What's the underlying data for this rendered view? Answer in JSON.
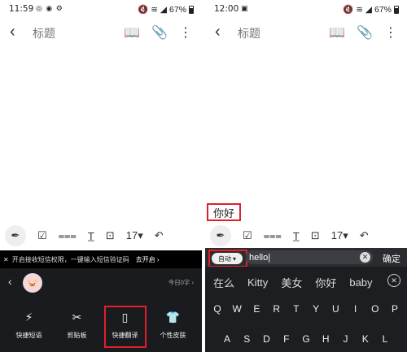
{
  "left": {
    "status": {
      "time": "11:59",
      "status_icons": "◎ ◉ ⚙",
      "right_icons": "🔇 ≋ ◢",
      "battery": "67%"
    },
    "topbar": {
      "title": "标题"
    },
    "format_toolbar": {
      "font_size": "17"
    },
    "notice": {
      "text": "开启接收短信权限，一键输入短信验证码",
      "action": "去开启"
    },
    "today_label": "今日0字",
    "tools": [
      {
        "label": "快捷短语",
        "icon": "phrase-icon"
      },
      {
        "label": "剪贴板",
        "icon": "scissors-icon"
      },
      {
        "label": "快捷翻译",
        "icon": "translate-icon"
      },
      {
        "label": "个性皮肤",
        "icon": "shirt-icon"
      }
    ]
  },
  "right": {
    "status": {
      "time": "12:00",
      "status_icons": "▣",
      "right_icons": "🔇 ≋ ◢",
      "battery": "67%"
    },
    "topbar": {
      "title": "标题"
    },
    "note_text": "你好",
    "format_toolbar": {
      "font_size": "17"
    },
    "translate_bar": {
      "mode": "自动",
      "input_value": "hello",
      "confirm": "确定"
    },
    "candidates": [
      "在么",
      "Kitty",
      "美女",
      "你好",
      "baby"
    ],
    "keyboard": {
      "row1": [
        "Q",
        "W",
        "E",
        "R",
        "T",
        "Y",
        "U",
        "I",
        "O",
        "P"
      ],
      "row2": [
        "A",
        "S",
        "D",
        "F",
        "G",
        "H",
        "J",
        "K",
        "L"
      ]
    }
  }
}
